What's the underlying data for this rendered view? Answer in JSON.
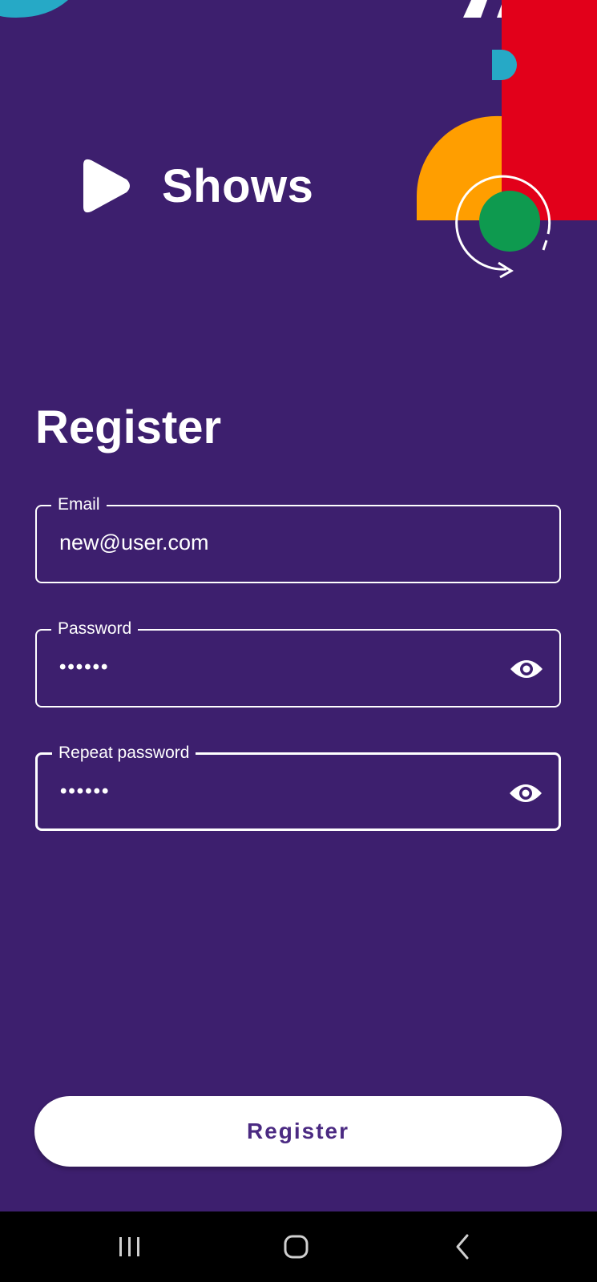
{
  "app": {
    "name": "Shows"
  },
  "page": {
    "title": "Register"
  },
  "form": {
    "email": {
      "label": "Email",
      "value": "new@user.com"
    },
    "password": {
      "label": "Password",
      "value": "••••••"
    },
    "repeat_password": {
      "label": "Repeat password",
      "value": "••••••"
    }
  },
  "actions": {
    "register_label": "Register"
  },
  "colors": {
    "background": "#3d1f6e",
    "accent_red": "#e2001a",
    "accent_orange": "#ff9e00",
    "accent_green": "#0e9a4f",
    "accent_teal": "#26a9c6",
    "button_text": "#4b2a82"
  },
  "icons": {
    "logo": "play-icon",
    "visibility": "eye-icon",
    "nav": [
      "recents-icon",
      "home-icon",
      "back-icon"
    ]
  }
}
